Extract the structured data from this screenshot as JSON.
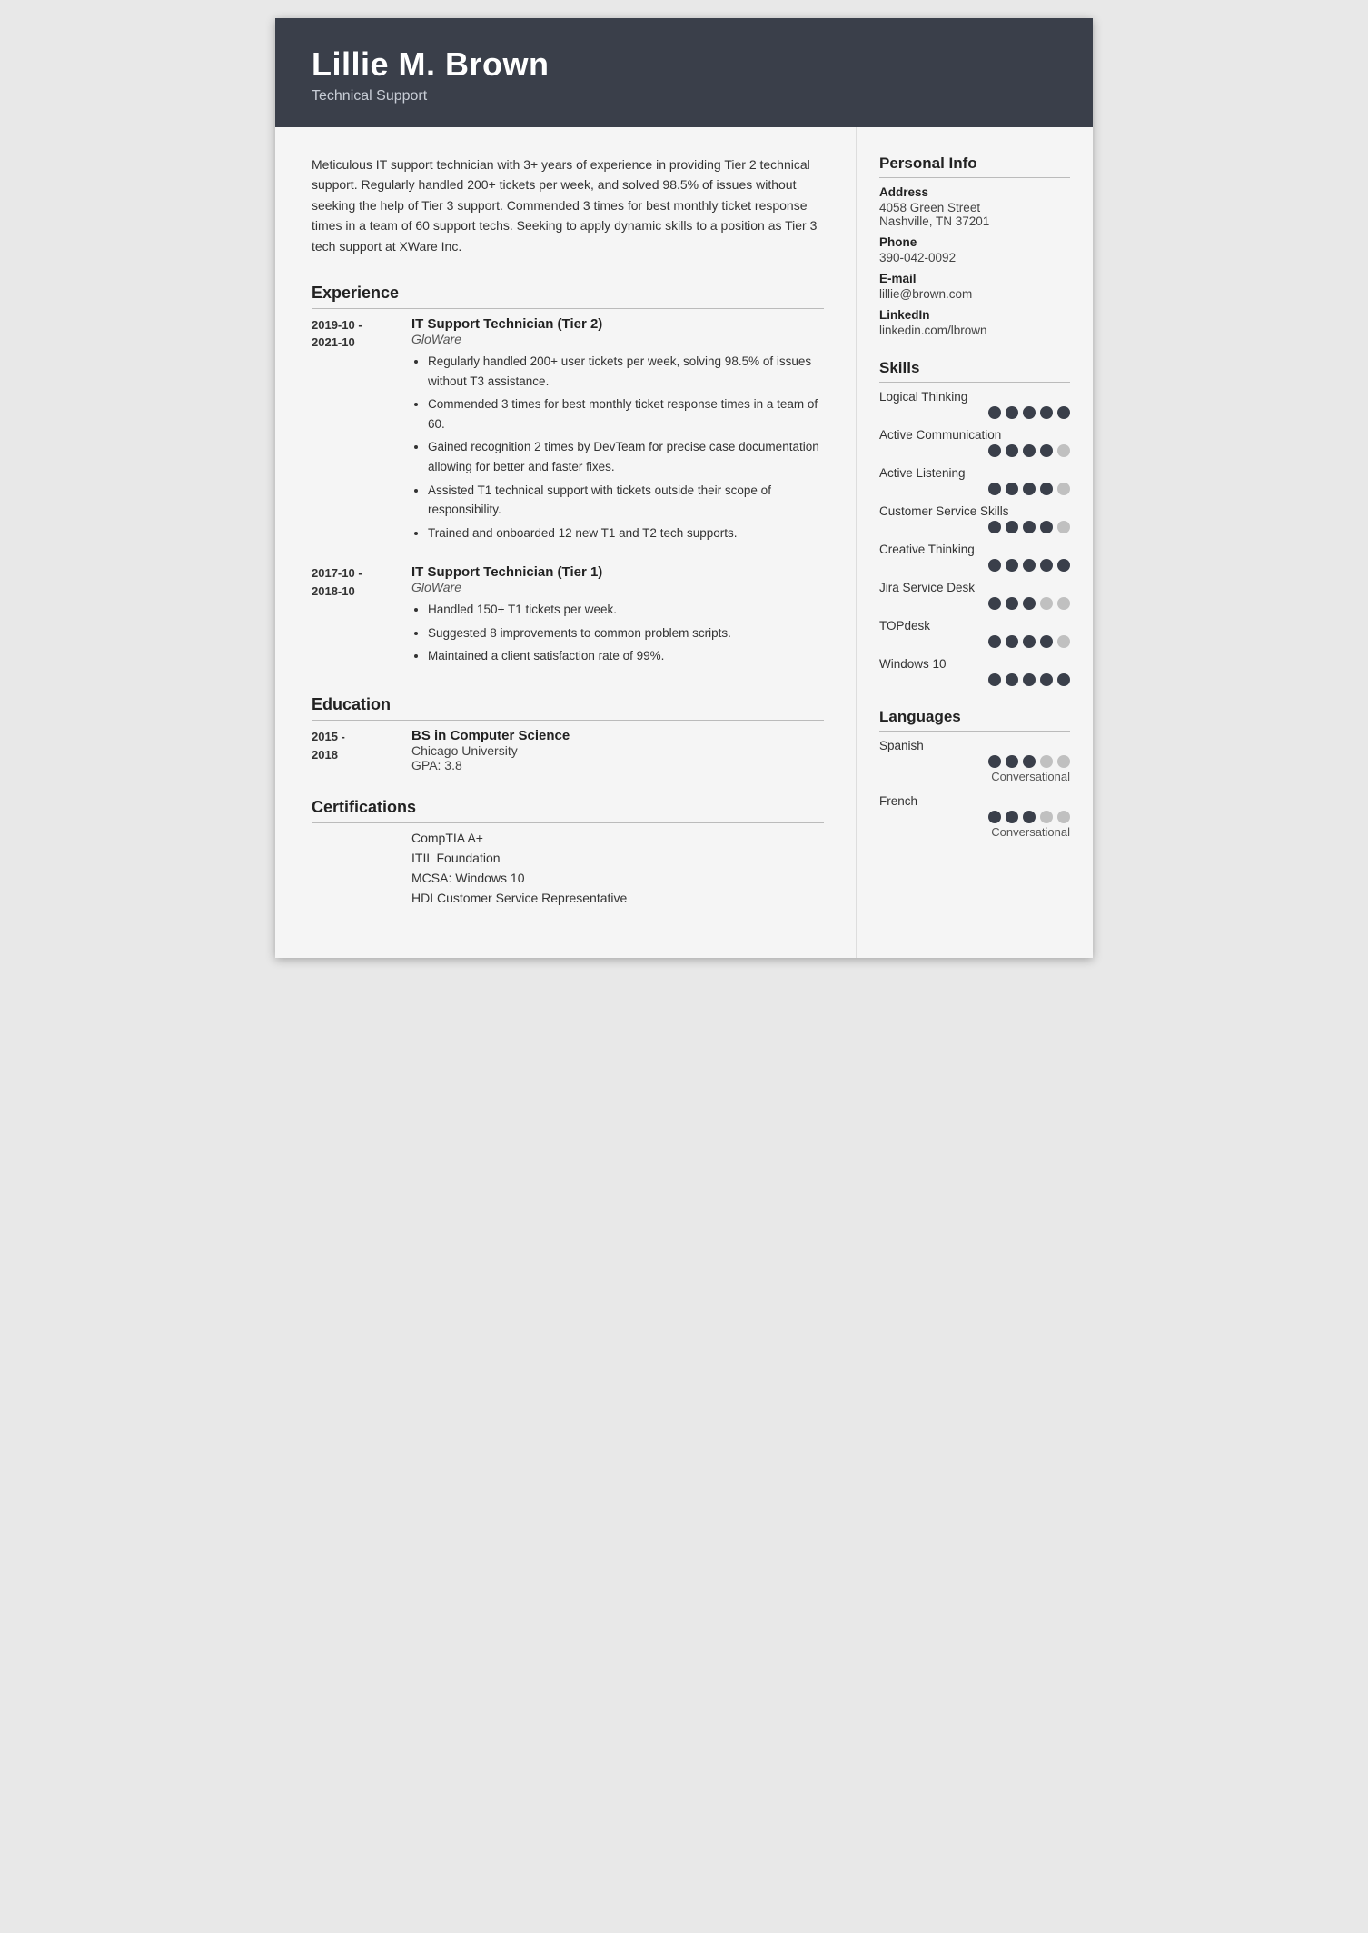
{
  "header": {
    "name": "Lillie M. Brown",
    "title": "Technical Support"
  },
  "summary": "Meticulous IT support technician with 3+ years of experience in providing Tier 2 technical support. Regularly handled 200+ tickets per week, and solved 98.5% of issues without seeking the help of Tier 3 support. Commended 3 times for best monthly ticket response times in a team of 60 support techs. Seeking to apply dynamic skills to a position as Tier 3 tech support at XWare Inc.",
  "sections": {
    "experience_title": "Experience",
    "education_title": "Education",
    "certifications_title": "Certifications"
  },
  "experience": [
    {
      "date": "2019-10 -\n2021-10",
      "title": "IT Support Technician (Tier 2)",
      "company": "GloWare",
      "bullets": [
        "Regularly handled 200+ user tickets per week, solving 98.5% of issues without T3 assistance.",
        "Commended 3 times for best monthly ticket response times in a team of 60.",
        "Gained recognition 2 times by DevTeam for precise case documentation allowing for better and faster fixes.",
        "Assisted T1 technical support with tickets outside their scope of responsibility.",
        "Trained and onboarded 12 new T1 and T2 tech supports."
      ]
    },
    {
      "date": "2017-10 -\n2018-10",
      "title": "IT Support Technician (Tier 1)",
      "company": "GloWare",
      "bullets": [
        "Handled 150+ T1 tickets per week.",
        "Suggested 8 improvements to common problem scripts.",
        "Maintained a client satisfaction rate of 99%."
      ]
    }
  ],
  "education": [
    {
      "date": "2015 -\n2018",
      "degree": "BS in Computer Science",
      "school": "Chicago University",
      "gpa": "GPA: 3.8"
    }
  ],
  "certifications": [
    "CompTIA A+",
    "ITIL Foundation",
    "MCSA: Windows 10",
    "HDI Customer Service Representative"
  ],
  "personal_info": {
    "title": "Personal Info",
    "address_label": "Address",
    "address_line1": "4058 Green Street",
    "address_line2": "Nashville, TN 37201",
    "phone_label": "Phone",
    "phone": "390-042-0092",
    "email_label": "E-mail",
    "email": "lillie@brown.com",
    "linkedin_label": "LinkedIn",
    "linkedin": "linkedin.com/lbrown"
  },
  "skills": {
    "title": "Skills",
    "items": [
      {
        "name": "Logical Thinking",
        "filled": 5,
        "total": 5
      },
      {
        "name": "Active Communication",
        "filled": 4,
        "total": 5
      },
      {
        "name": "Active Listening",
        "filled": 4,
        "total": 5
      },
      {
        "name": "Customer Service Skills",
        "filled": 4,
        "total": 5
      },
      {
        "name": "Creative Thinking",
        "filled": 5,
        "total": 5
      },
      {
        "name": "Jira Service Desk",
        "filled": 3,
        "total": 5
      },
      {
        "name": "TOPdesk",
        "filled": 4,
        "total": 5
      },
      {
        "name": "Windows 10",
        "filled": 5,
        "total": 5
      }
    ]
  },
  "languages": {
    "title": "Languages",
    "items": [
      {
        "name": "Spanish",
        "filled": 3,
        "total": 5,
        "level": "Conversational"
      },
      {
        "name": "French",
        "filled": 3,
        "total": 5,
        "level": "Conversational"
      }
    ]
  }
}
